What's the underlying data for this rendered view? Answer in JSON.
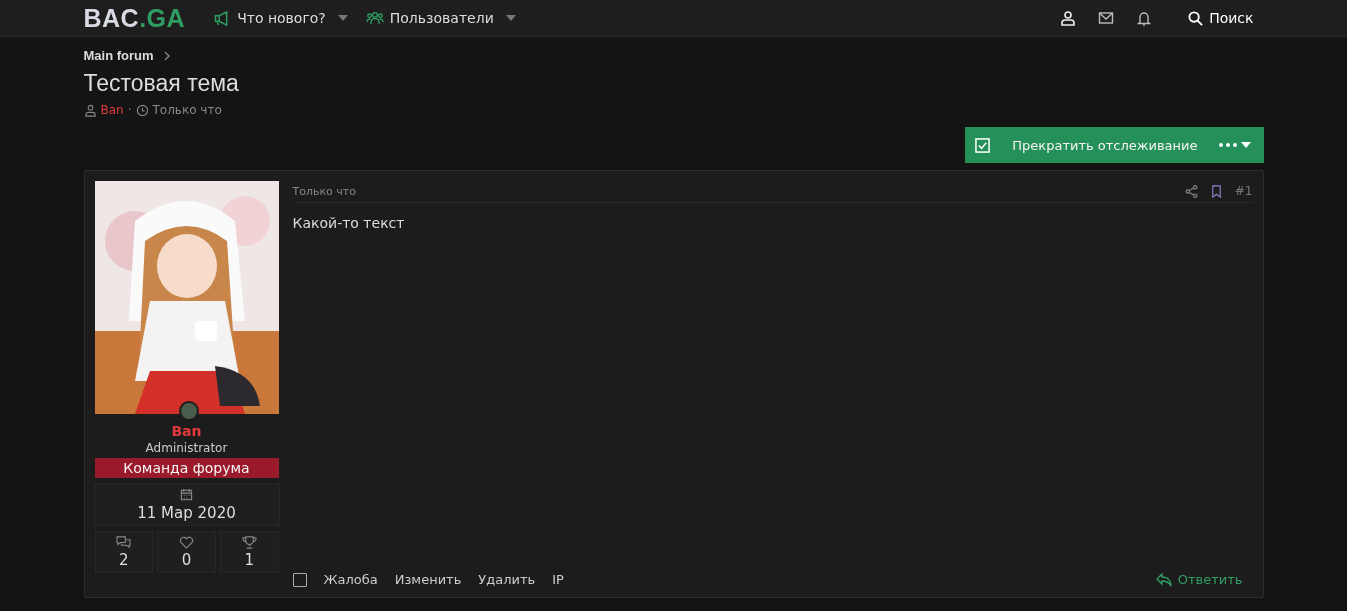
{
  "header": {
    "logo_main": "BAC",
    "logo_accent": ".GA",
    "nav": [
      {
        "label": "Что нового?",
        "kind": "megaphone"
      },
      {
        "label": "Пользователи",
        "kind": "users"
      }
    ],
    "search": "Поиск"
  },
  "breadcrumb": [
    "Main forum"
  ],
  "thread": {
    "title": "Тестовая тема",
    "author": "Ban",
    "separator": "·",
    "time": "Только что"
  },
  "watch_button": "Прекратить отслеживание",
  "post": {
    "user": {
      "name": "Ban",
      "title": "Administrator",
      "banner": "Команда форума",
      "joined": "11 Мар 2020",
      "stats": [
        {
          "kind": "messages",
          "value": "2"
        },
        {
          "kind": "heart",
          "value": "0"
        },
        {
          "kind": "trophy",
          "value": "1"
        }
      ]
    },
    "time": "Только что",
    "number": "#1",
    "body": "Какой-то текст",
    "selected": false,
    "actions": [
      "Жалоба",
      "Изменить",
      "Удалить",
      "IP"
    ],
    "reply": "Ответить"
  }
}
